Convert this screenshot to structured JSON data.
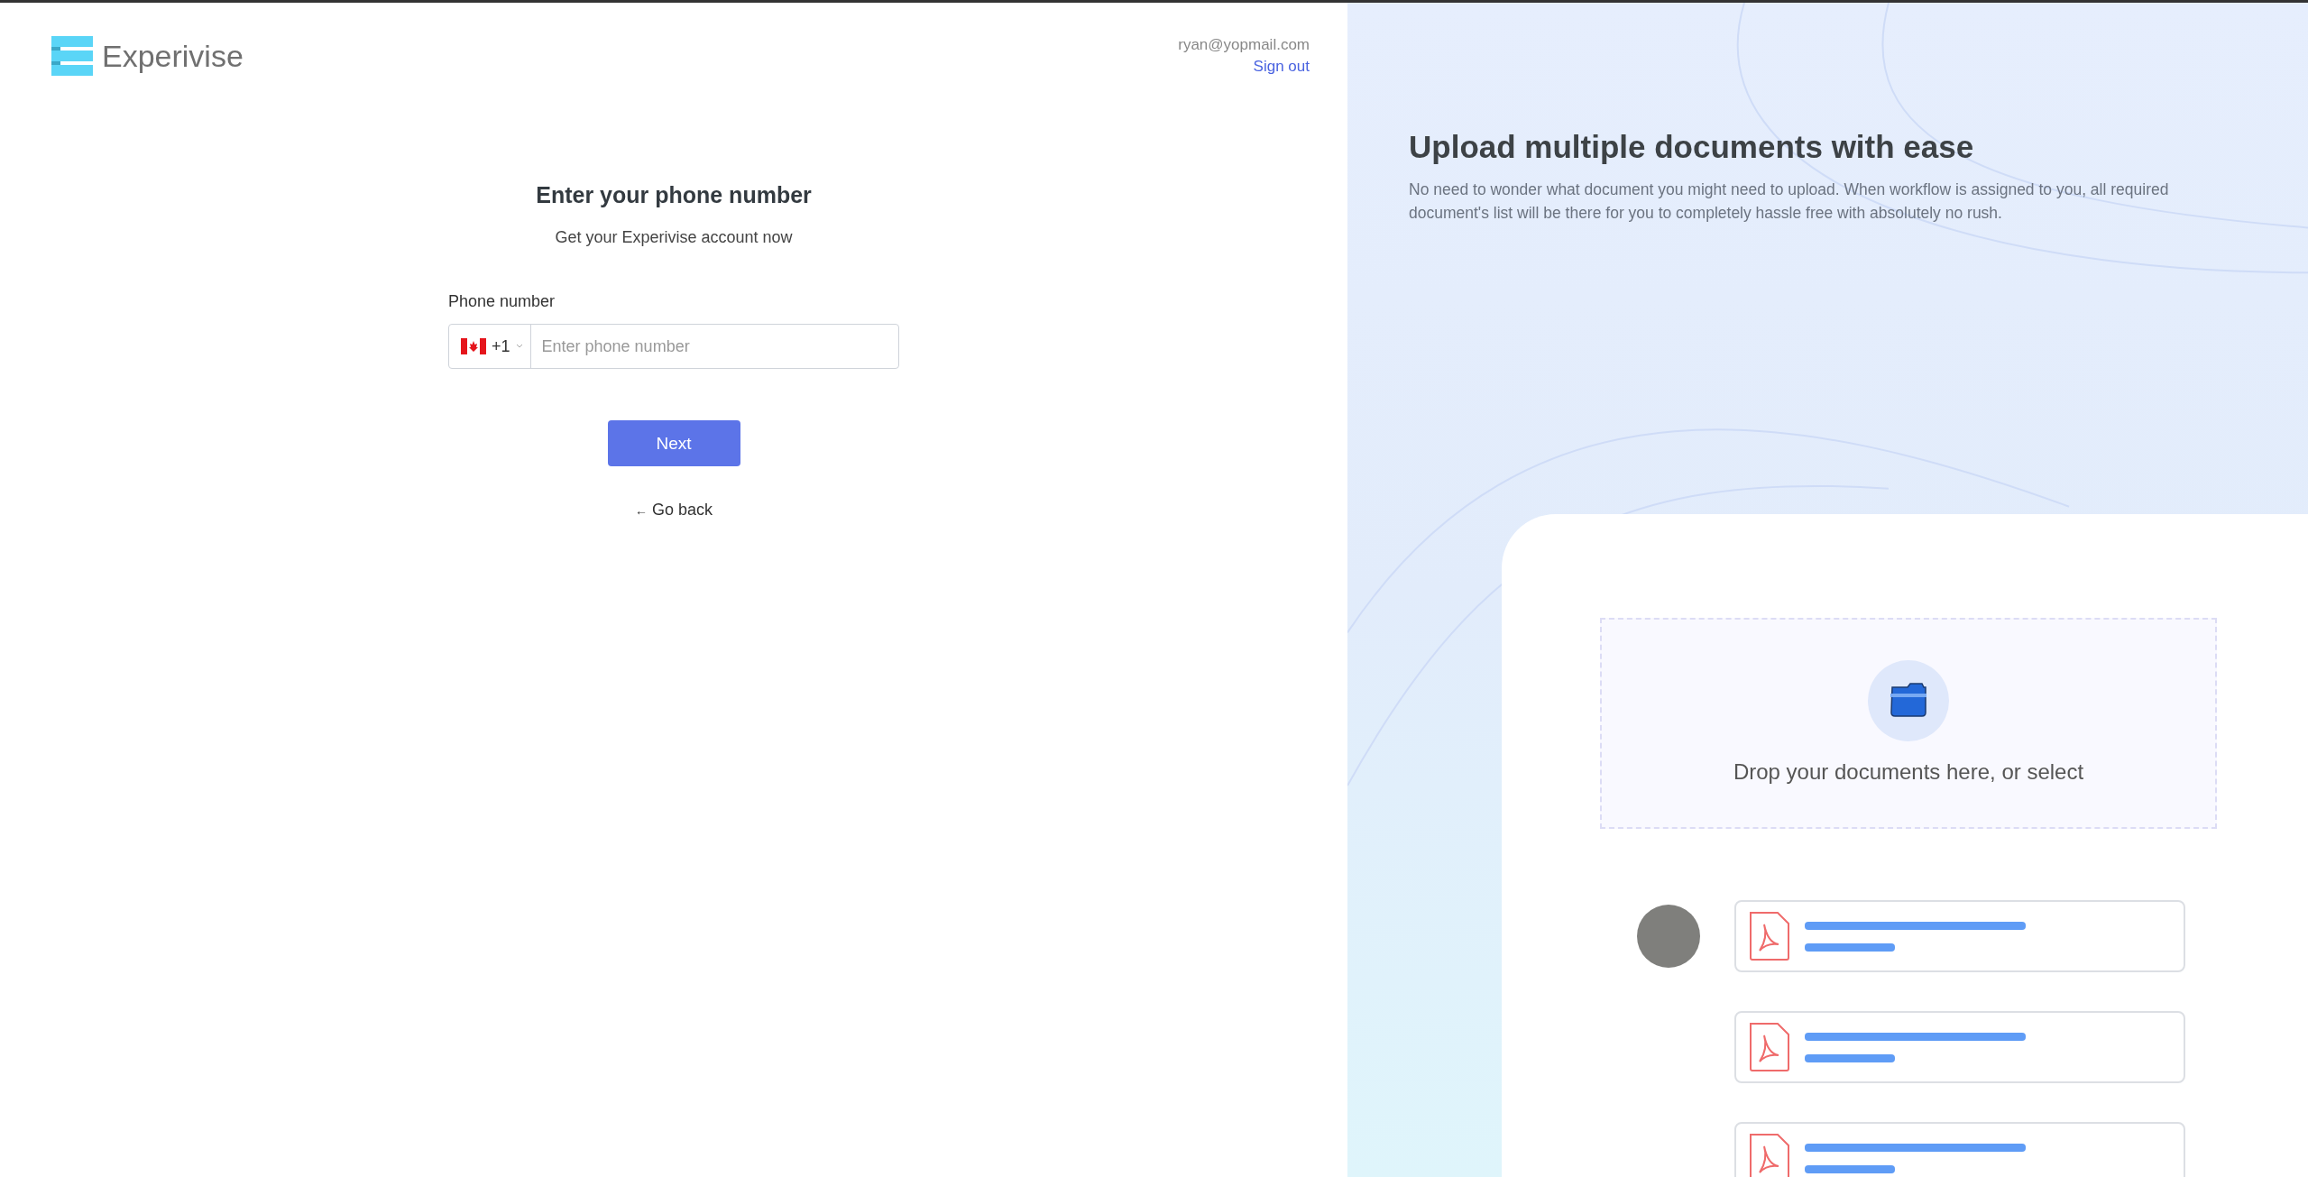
{
  "header": {
    "brand": "Experivise",
    "user_email": "ryan@yopmail.com",
    "sign_out": "Sign out"
  },
  "form": {
    "title": "Enter your phone number",
    "subtitle": "Get your Experivise account now",
    "phone_label": "Phone number",
    "country_code": "+1",
    "placeholder": "Enter phone number",
    "next": "Next",
    "back_arrow": "←",
    "go_back": "Go back"
  },
  "promo": {
    "title": "Upload multiple documents with ease",
    "text": "No need to wonder what document you might need to upload. When workflow is assigned to you, all required document's list will be there for you to completely hassle free with absolutely no rush.",
    "drop_text": "Drop your documents here, or select"
  }
}
